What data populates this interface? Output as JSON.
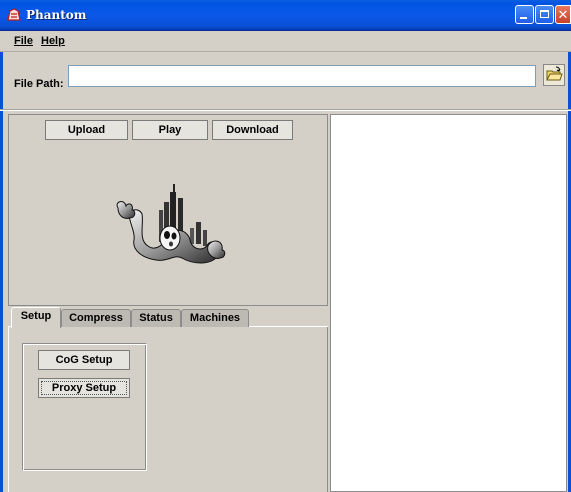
{
  "window": {
    "title": "Phantom",
    "icon": "phantom-app-icon",
    "controls": [
      "minimize-icon",
      "maximize-icon",
      "close-icon"
    ]
  },
  "menubar": {
    "items": [
      {
        "label": "File",
        "mnemonic": "F"
      },
      {
        "label": "Help",
        "mnemonic": "H"
      }
    ]
  },
  "path": {
    "label": "File Path:",
    "value": "",
    "open_icon": "open-folder-icon"
  },
  "transfer": {
    "upload_label": "Upload",
    "play_label": "Play",
    "download_label": "Download"
  },
  "logo": {
    "icon": "ghost-logo"
  },
  "tabs": [
    {
      "label": "Setup",
      "active": true
    },
    {
      "label": "Compress",
      "active": false
    },
    {
      "label": "Status",
      "active": false
    },
    {
      "label": "Machines",
      "active": false
    }
  ],
  "setup": {
    "cog_label": "CoG Setup",
    "proxy_label": "Proxy Setup"
  },
  "colors": {
    "titlebar": "#0a58e8",
    "window_bg": "#d4d0c8",
    "panel_bg": "#ffffff"
  }
}
